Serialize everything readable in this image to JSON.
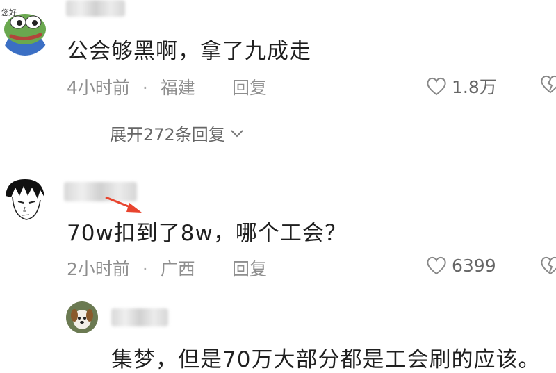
{
  "comments": [
    {
      "avatar_badge": "您好",
      "text": "公会够黑啊，拿了九成走",
      "time": "4小时前",
      "location": "福建",
      "reply_label": "回复",
      "likes": "1.8万",
      "expand_text": "展开272条回复"
    },
    {
      "text": "70w扣到了8w，哪个工会？",
      "time": "2小时前",
      "location": "广西",
      "reply_label": "回复",
      "likes": "6399"
    }
  ],
  "reply": {
    "text": "集梦，但是70万大部分都是工会刷的应该。"
  },
  "meta_separator": "·",
  "colors": {
    "arrow": "#e8442e",
    "meta": "#8e8e8e"
  },
  "icons": [
    "heart-outline-icon",
    "broken-heart-icon",
    "chevron-down-icon",
    "red-arrow-annotation"
  ]
}
